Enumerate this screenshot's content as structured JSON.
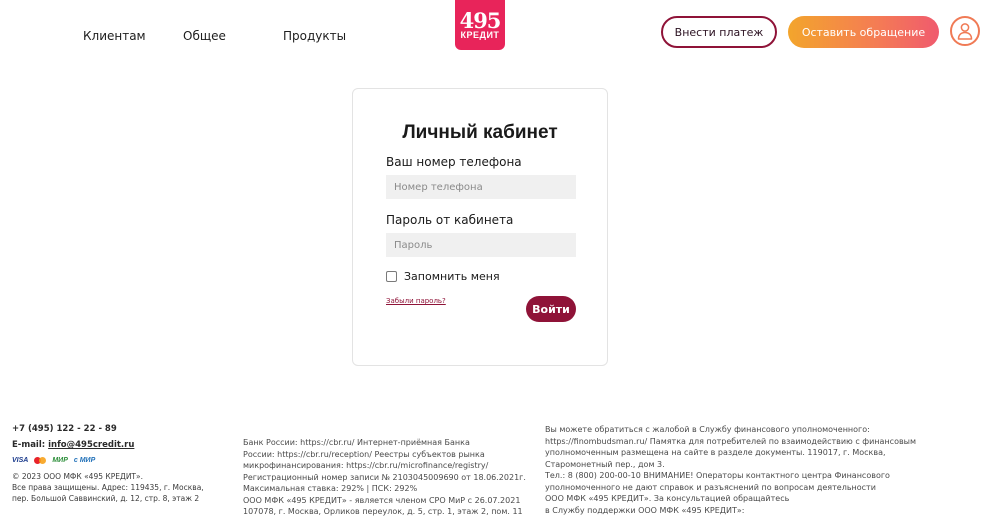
{
  "header": {
    "nav": [
      "Клиентам",
      "Общее",
      "Продукты"
    ],
    "logo": {
      "number": "495",
      "word": "КРЕДИТ"
    },
    "pay_button": "Внести платеж",
    "appeal_button": "Оставить обращение",
    "user_icon": "user-icon",
    "colors": {
      "brand": "#e8245a",
      "primary": "#8f1338",
      "gradient_start": "#f3a52c",
      "gradient_end": "#f05a6e"
    }
  },
  "login": {
    "title": "Личный кабинет",
    "phone_label": "Ваш номер телефона",
    "phone_placeholder": "Номер телефона",
    "password_label": "Пароль от кабинета",
    "password_placeholder": "Пароль",
    "remember_label": "Запомнить меня",
    "remember_checked": false,
    "forgot_link": "Забыли пароль?",
    "submit_button": "Войти"
  },
  "footer": {
    "phone": "+7 (495) 122 - 22 - 89",
    "email_label": "E-mail:",
    "email": "info@495credit.ru",
    "payment_logos": [
      "VISA",
      "mastercard",
      "МИР",
      "с МИР"
    ],
    "copyright": [
      "© 2023 ООО МФК «495 КРЕДИТ».",
      "Все права защищены. Адрес: 119435, г. Москва,",
      "пер. Большой Саввинский, д. 12, стр. 8, этаж 2"
    ],
    "col2": [
      "Банк России: https://cbr.ru/ Интернет-приёмная Банка",
      "России: https://cbr.ru/reception/ Реестры субъектов рынка",
      "микрофинансирования: https://cbr.ru/microfinance/registry/",
      "Регистрационный номер записи  № 2103045009690 от 18.06.2021г.",
      "Максимальная ставка: 292% | ПСК: 292%",
      "ООО МФК «495 КРЕДИТ» - является членом СРО МиР с 26.07.2021",
      "107078, г. Москва, Орликов переулок, д. 5, стр. 1, этаж 2, пом. 11"
    ],
    "col3": [
      "Вы можете обратиться с жалобой в Службу финансового уполномоченного:",
      "https://finombudsman.ru/ Памятка для потребителей по взаимодействию с финансовым",
      "уполномоченным размещена на сайте в разделе документы. 119017, г. Москва,",
      "Старомонетный пер., дом 3.",
      "Тел.: 8 (800) 200-00-10 ВНИМАНИЕ! Операторы контактного центра Финансового",
      "уполномоченного не дают справок и разъяснений по вопросам деятельности",
      "ООО МФК «495 КРЕДИТ». За консультацией обращайтесь",
      "в Службу поддержки ООО МФК «495 КРЕДИТ»:"
    ]
  }
}
